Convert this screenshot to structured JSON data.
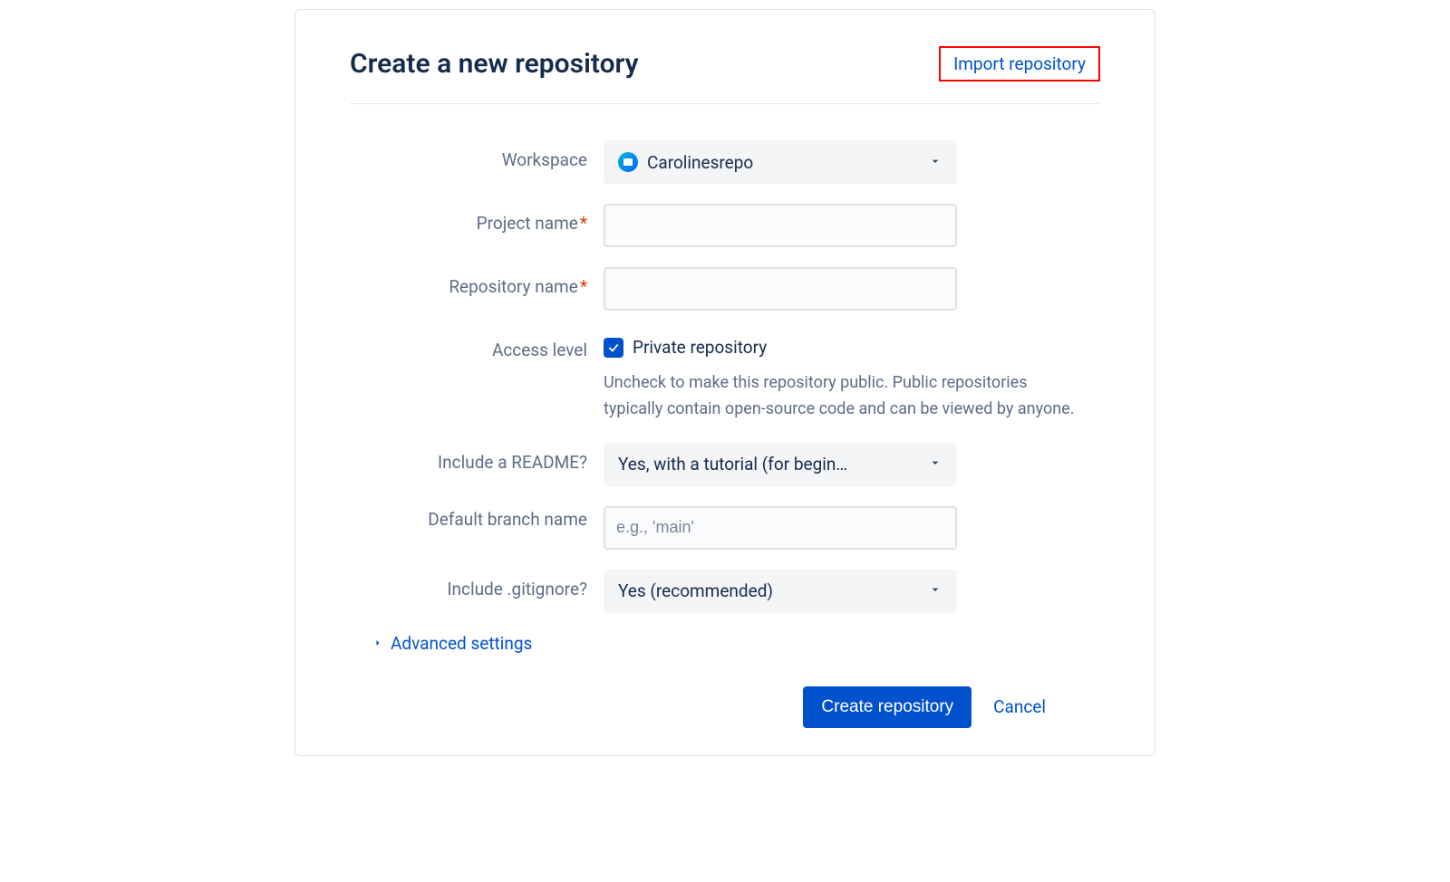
{
  "header": {
    "title": "Create a new repository",
    "import_link": "Import repository"
  },
  "form": {
    "workspace": {
      "label": "Workspace",
      "value": "Carolinesrepo"
    },
    "project_name": {
      "label": "Project name",
      "value": ""
    },
    "repository_name": {
      "label": "Repository name",
      "value": ""
    },
    "access_level": {
      "label": "Access level",
      "checkbox_label": "Private repository",
      "checked": true,
      "help": "Uncheck to make this repository public. Public repositories typically contain open-source code and can be viewed by anyone."
    },
    "readme": {
      "label": "Include a README?",
      "value": "Yes, with a tutorial (for begin…"
    },
    "default_branch": {
      "label": "Default branch name",
      "placeholder": "e.g., 'main'",
      "value": ""
    },
    "gitignore": {
      "label": "Include .gitignore?",
      "value": "Yes (recommended)"
    },
    "advanced": "Advanced settings"
  },
  "footer": {
    "create": "Create repository",
    "cancel": "Cancel"
  }
}
